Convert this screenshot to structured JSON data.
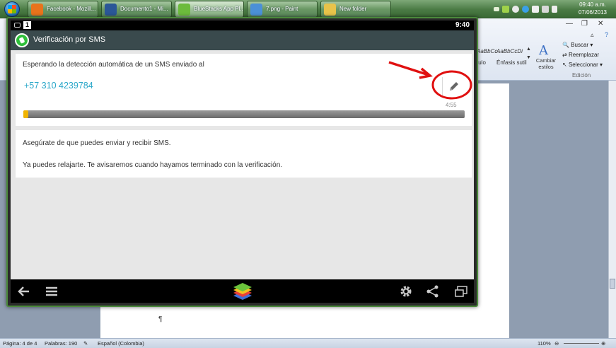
{
  "taskbar": {
    "buttons": [
      {
        "label": "Facebook - Mozill...",
        "icon": "firefox-icon",
        "color": "#e8731c"
      },
      {
        "label": "Documento1 - Mi...",
        "icon": "word-icon",
        "color": "#2b5797"
      },
      {
        "label": "BlueStacks App Pl...",
        "icon": "bluestacks-icon",
        "color": "#6cbb3c"
      },
      {
        "label": "7.png - Paint",
        "icon": "paint-icon",
        "color": "#4b90d8"
      },
      {
        "label": "New folder",
        "icon": "folder-icon",
        "color": "#e8c34a"
      }
    ],
    "clock_time": "09:40 a.m.",
    "clock_date": "07/06/2013"
  },
  "word": {
    "styles": [
      {
        "preview": "AaBbCc.",
        "label": "tulo"
      },
      {
        "preview": "AaBbCcDi",
        "label": "Énfasis sutil"
      }
    ],
    "cambiar_estilos": "Cambiar estilos",
    "edit": {
      "buscar": "Buscar",
      "reemplazar": "Reemplazar",
      "seleccionar": "Seleccionar",
      "group_label": "Edición"
    },
    "pilcrow": "¶",
    "status": {
      "page": "Página: 4 de 4",
      "words": "Palabras: 190",
      "language": "Español (Colombia)",
      "zoom": "110%"
    }
  },
  "android": {
    "notification_badge": "1",
    "time": "9:40",
    "app_title": "Verificación por SMS",
    "waiting_text": "Esperando la detección automática de un SMS enviado al",
    "phone_number": "+57 310 4239784",
    "timer": "4:55",
    "progress_fraction": 0.012,
    "info_line1": "Asegúrate de que puedes enviar y recibir SMS.",
    "info_line2": "Ya puedes relajarte. Te avisaremos cuando hayamos terminado con la verificación."
  },
  "colors": {
    "phone": "#2aa7c9",
    "app_bar": "#3a4a4d",
    "annotation": "#e01010",
    "progress_fill": "#f0b400"
  }
}
